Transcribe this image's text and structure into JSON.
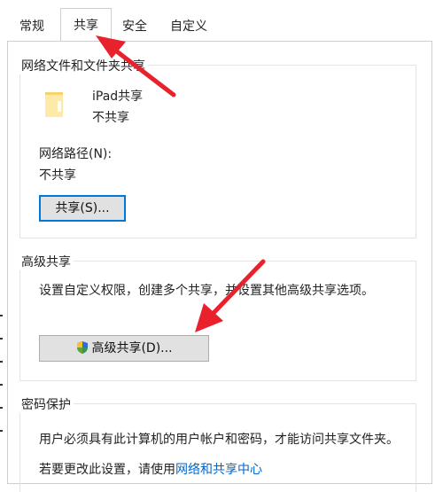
{
  "tabs": [
    "常规",
    "共享",
    "安全",
    "自定义"
  ],
  "network_sharing": {
    "group_title": "网络文件和文件夹共享",
    "item_name": "iPad共享",
    "item_status": "不共享",
    "path_label": "网络路径(N):",
    "path_value": "不共享",
    "share_button": "共享(S)..."
  },
  "advanced_sharing": {
    "group_title": "高级共享",
    "description": "设置自定义权限，创建多个共享，并设置其他高级共享选项。",
    "button": "高级共享(D)..."
  },
  "password_protection": {
    "group_title": "密码保护",
    "description": "用户必须具有此计算机的用户帐户和密码，才能访问共享文件夹。",
    "change_prefix": "若要更改此设置，请使用",
    "change_link": "网络和共享中心"
  },
  "colors": {
    "arrow": "#e8212d",
    "link": "#0066cc",
    "focus": "#0078d7"
  }
}
